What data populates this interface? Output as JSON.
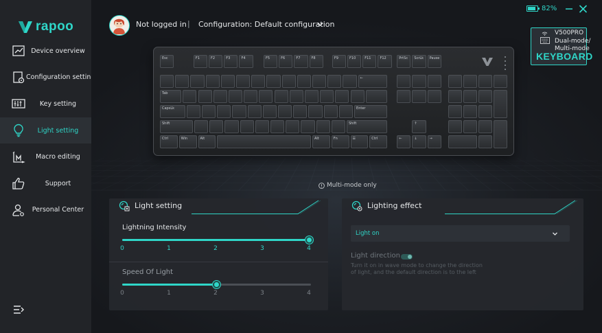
{
  "brand": {
    "name": "rapoo",
    "color": "#2fd6c8"
  },
  "sidebar": {
    "items": [
      {
        "label": "Device overview",
        "icon": "device-overview-icon",
        "active": false
      },
      {
        "label": "Configuration setting",
        "icon": "configuration-icon",
        "active": false
      },
      {
        "label": "Key setting",
        "icon": "key-setting-icon",
        "active": false
      },
      {
        "label": "Light setting",
        "icon": "light-bulb-icon",
        "active": true
      },
      {
        "label": "Macro editing",
        "icon": "macro-icon",
        "active": false
      },
      {
        "label": "Support",
        "icon": "thumbs-up-icon",
        "active": false
      },
      {
        "label": "Personal Center",
        "icon": "person-icon",
        "active": false
      }
    ],
    "collapse_icon": "collapse-menu-icon"
  },
  "header": {
    "login_status": "Not logged in",
    "separator": "|",
    "configuration": "Configuration: Default configuration",
    "battery_percent": 82,
    "battery_label": "82%",
    "minimize_icon": "minimize-icon",
    "close_icon": "close-icon"
  },
  "device": {
    "name_lines": [
      "V500PRO",
      "Dual-mode/",
      "Multi-mode"
    ],
    "type": "KEYBOARD"
  },
  "keyboard": {
    "keys": {
      "esc": "Esc",
      "f1": "F1",
      "f2": "F2",
      "f3": "F3",
      "f4": "F4",
      "f5": "F5",
      "f6": "F6",
      "f7": "F7",
      "f8": "F8",
      "f9": "F9",
      "f10": "F10",
      "f11": "F11",
      "f12": "F12",
      "prtsc": "PrtSc",
      "scrlk": "ScrLk",
      "pause": "Pause",
      "tab": "Tab",
      "capslock": "CapsLk",
      "lshift": "Shift",
      "rshift": "Shift",
      "enter": "Enter",
      "backspace": "←",
      "lctrl": "Ctrl",
      "win": "Win",
      "lalt": "Alt",
      "ralt": "Alt",
      "fn": "Fn",
      "menu": "☰",
      "rctrl": "Ctrl"
    }
  },
  "notice": {
    "text": "Multi-mode only"
  },
  "light_setting": {
    "title": "Light setting",
    "intensity": {
      "label": "Lightning Intensity",
      "ticks": [
        "0",
        "1",
        "2",
        "3",
        "4"
      ],
      "value": 4,
      "max": 4
    },
    "speed": {
      "label": "Speed Of Light",
      "ticks": [
        "0",
        "1",
        "2",
        "3",
        "4"
      ],
      "value": 2,
      "max": 4
    }
  },
  "lighting_effect": {
    "title": "Lighting effect",
    "selected": "Light on",
    "direction_label": "Light direction",
    "direction_desc": "Turn it on in wave mode to change the direction of light, and the default direction is to the left"
  }
}
